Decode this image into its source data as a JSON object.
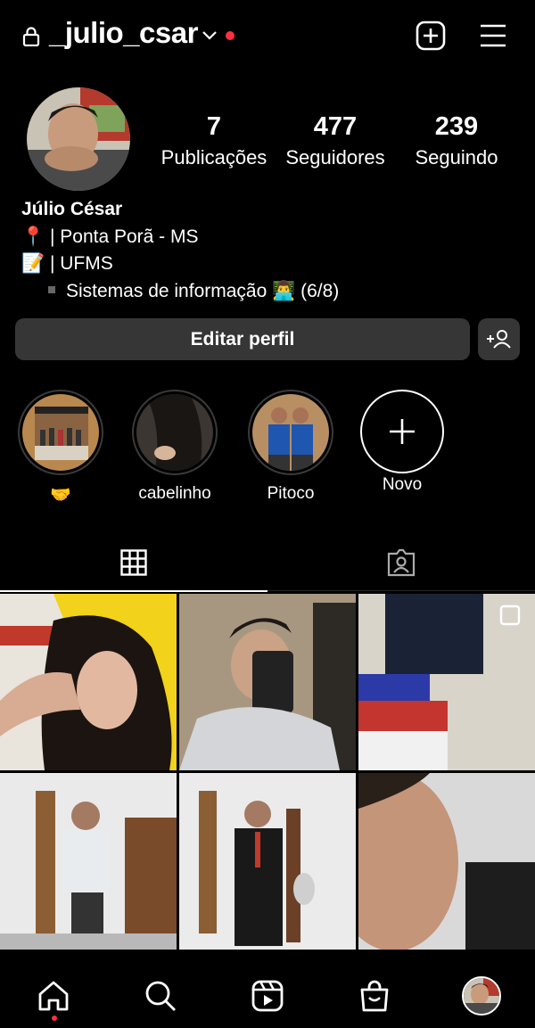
{
  "header": {
    "username": "_julio_csar"
  },
  "stats": [
    {
      "value": "7",
      "label": "Publicações"
    },
    {
      "value": "477",
      "label": "Seguidores"
    },
    {
      "value": "239",
      "label": "Seguindo"
    }
  ],
  "bio": {
    "name": "Júlio César",
    "line1": "📍 | Ponta Porã - MS",
    "line2": "📝 | UFMS",
    "line3": "Sistemas de informação 👨‍💻 (6/8)"
  },
  "actions": {
    "edit_profile": "Editar perfil"
  },
  "highlights": [
    {
      "label": "🤝"
    },
    {
      "label": "cabelinho"
    },
    {
      "label": "Pitoco"
    },
    {
      "label": "Novo"
    }
  ],
  "colors": {
    "background": "#000000",
    "button": "#363636",
    "notification": "#ff3040"
  }
}
